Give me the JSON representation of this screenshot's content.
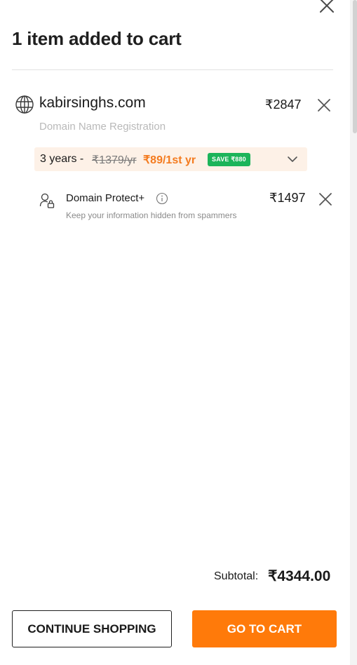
{
  "header": {
    "title": "1 item added to cart",
    "close_icon": "close-icon"
  },
  "cart_item": {
    "icon": "globe-icon",
    "domain": "kabirsinghs.com",
    "type": "Domain Name Registration",
    "price": "₹2847",
    "term": {
      "years": "3 years -",
      "old_price": "₹1379/yr",
      "new_price": "₹89/1st yr",
      "save_badge": "SAVE ₹880",
      "icon": "chevron-down-icon"
    }
  },
  "addon": {
    "icon": "user-lock-icon",
    "name": "Domain Protect+",
    "info_icon": "info-icon",
    "description": "Keep your information hidden from spammers",
    "price": "₹1497"
  },
  "summary": {
    "subtotal_label": "Subtotal:",
    "subtotal_value": "₹4344.00"
  },
  "actions": {
    "continue_label": "CONTINUE SHOPPING",
    "go_to_cart_label": "GO TO CART"
  },
  "colors": {
    "accent": "#ff7a0a",
    "price_orange": "#f47b1f",
    "save_green": "#1cb45a",
    "term_bg": "#fdf1e7"
  }
}
